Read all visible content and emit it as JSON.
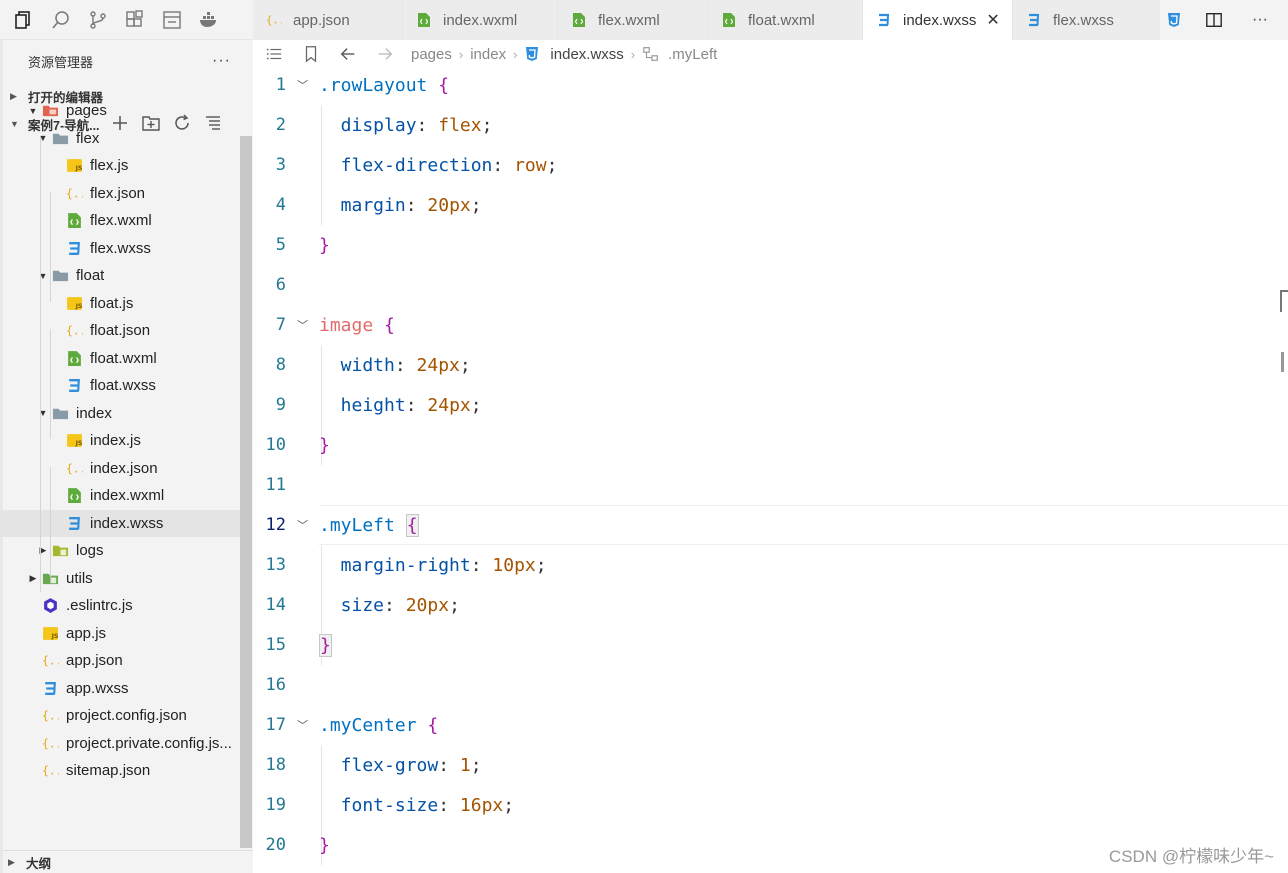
{
  "activity_bar": {
    "icons": [
      "files-icon",
      "search-icon",
      "source-control-icon",
      "extensions-icon",
      "debug-console-icon",
      "docker-icon"
    ]
  },
  "explorer": {
    "title": "资源管理器",
    "more": "···",
    "open_editors": "打开的编辑器",
    "project": "案例7-导航...",
    "outline": "大纲"
  },
  "tree": [
    {
      "label": "pages",
      "icon": "folder-pages-icon",
      "twisty": "▼"
    },
    {
      "label": "flex",
      "icon": "folder-icon",
      "twisty": "▼"
    },
    {
      "label": "flex.js",
      "icon": "js-file-icon"
    },
    {
      "label": "flex.json",
      "icon": "json-file-icon"
    },
    {
      "label": "flex.wxml",
      "icon": "wxml-file-icon"
    },
    {
      "label": "flex.wxss",
      "icon": "wxss-file-icon"
    },
    {
      "label": "float",
      "icon": "folder-icon",
      "twisty": "▼"
    },
    {
      "label": "float.js",
      "icon": "js-file-icon"
    },
    {
      "label": "float.json",
      "icon": "json-file-icon"
    },
    {
      "label": "float.wxml",
      "icon": "wxml-file-icon"
    },
    {
      "label": "float.wxss",
      "icon": "wxss-file-icon"
    },
    {
      "label": "index",
      "icon": "folder-icon",
      "twisty": "▼"
    },
    {
      "label": "index.js",
      "icon": "js-file-icon"
    },
    {
      "label": "index.json",
      "icon": "json-file-icon"
    },
    {
      "label": "index.wxml",
      "icon": "wxml-file-icon"
    },
    {
      "label": "index.wxss",
      "icon": "wxss-file-icon",
      "selected": true
    },
    {
      "label": "logs",
      "icon": "folder-logs-icon",
      "twisty": "▶"
    },
    {
      "label": "utils",
      "icon": "folder-utils-icon",
      "twisty": "▶"
    },
    {
      "label": ".eslintrc.js",
      "icon": "eslint-file-icon"
    },
    {
      "label": "app.js",
      "icon": "js-file-icon"
    },
    {
      "label": "app.json",
      "icon": "json-file-icon"
    },
    {
      "label": "app.wxss",
      "icon": "wxss-file-icon"
    },
    {
      "label": "project.config.json",
      "icon": "json-file-icon"
    },
    {
      "label": "project.private.config.js...",
      "icon": "json-file-icon"
    },
    {
      "label": "sitemap.json",
      "icon": "json-file-icon"
    }
  ],
  "tabs": [
    {
      "label": "app.json",
      "icon": "json-file-icon"
    },
    {
      "label": "index.wxml",
      "icon": "wxml-file-icon"
    },
    {
      "label": "flex.wxml",
      "icon": "wxml-file-icon"
    },
    {
      "label": "float.wxml",
      "icon": "wxml-file-icon"
    },
    {
      "label": "index.wxss",
      "icon": "wxss-file-icon",
      "active": true,
      "close": "✕"
    },
    {
      "label": "flex.wxss",
      "icon": "wxss-file-icon"
    }
  ],
  "breadcrumb": {
    "items": [
      "pages",
      "index",
      "index.wxss",
      ".myLeft"
    ]
  },
  "editor": {
    "current_line": 12,
    "lines": [
      {
        "n": "1",
        "fold": "﹀",
        "tokens": [
          [
            ".rowLayout",
            "sel-c"
          ],
          [
            " ",
            ""
          ],
          [
            "{",
            "brace"
          ]
        ]
      },
      {
        "n": "2",
        "tokens": [
          [
            "  display",
            "prop"
          ],
          [
            ": ",
            "punc"
          ],
          [
            "flex",
            "val"
          ],
          [
            ";",
            "punc"
          ]
        ]
      },
      {
        "n": "3",
        "tokens": [
          [
            "  flex-direction",
            "prop"
          ],
          [
            ": ",
            "punc"
          ],
          [
            "row",
            "val"
          ],
          [
            ";",
            "punc"
          ]
        ]
      },
      {
        "n": "4",
        "tokens": [
          [
            "  margin",
            "prop"
          ],
          [
            ": ",
            "punc"
          ],
          [
            "20px",
            "val"
          ],
          [
            ";",
            "punc"
          ]
        ]
      },
      {
        "n": "5",
        "tokens": [
          [
            "}",
            "brace"
          ]
        ]
      },
      {
        "n": "6",
        "tokens": []
      },
      {
        "n": "7",
        "fold": "﹀",
        "tokens": [
          [
            "image",
            "tag"
          ],
          [
            " ",
            ""
          ],
          [
            "{",
            "brace"
          ]
        ]
      },
      {
        "n": "8",
        "tokens": [
          [
            "  width",
            "prop"
          ],
          [
            ": ",
            "punc"
          ],
          [
            "24px",
            "val"
          ],
          [
            ";",
            "punc"
          ]
        ]
      },
      {
        "n": "9",
        "tokens": [
          [
            "  height",
            "prop"
          ],
          [
            ": ",
            "punc"
          ],
          [
            "24px",
            "val"
          ],
          [
            ";",
            "punc"
          ]
        ]
      },
      {
        "n": "10",
        "tokens": [
          [
            "}",
            "brace"
          ]
        ]
      },
      {
        "n": "11",
        "tokens": []
      },
      {
        "n": "12",
        "fold": "﹀",
        "tokens": [
          [
            ".myLeft",
            "sel-c"
          ],
          [
            " ",
            ""
          ],
          [
            "{",
            "brace brk-box"
          ]
        ]
      },
      {
        "n": "13",
        "tokens": [
          [
            "  margin-right",
            "prop"
          ],
          [
            ": ",
            "punc"
          ],
          [
            "10px",
            "val"
          ],
          [
            ";",
            "punc"
          ]
        ]
      },
      {
        "n": "14",
        "tokens": [
          [
            "  size",
            "prop"
          ],
          [
            ": ",
            "punc"
          ],
          [
            "20px",
            "val"
          ],
          [
            ";",
            "punc"
          ]
        ]
      },
      {
        "n": "15",
        "tokens": [
          [
            "}",
            "brace brk-box"
          ]
        ]
      },
      {
        "n": "16",
        "tokens": []
      },
      {
        "n": "17",
        "fold": "﹀",
        "tokens": [
          [
            ".myCenter",
            "sel-c"
          ],
          [
            " ",
            ""
          ],
          [
            "{",
            "brace"
          ]
        ]
      },
      {
        "n": "18",
        "tokens": [
          [
            "  flex-grow",
            "prop"
          ],
          [
            ": ",
            "punc"
          ],
          [
            "1",
            "val"
          ],
          [
            ";",
            "punc"
          ]
        ]
      },
      {
        "n": "19",
        "tokens": [
          [
            "  font-size",
            "prop"
          ],
          [
            ": ",
            "punc"
          ],
          [
            "16px",
            "val"
          ],
          [
            ";",
            "punc"
          ]
        ]
      },
      {
        "n": "20",
        "tokens": [
          [
            "}",
            "brace"
          ]
        ]
      }
    ]
  },
  "watermark": "CSDN @柠檬味少年~",
  "colors": {
    "wxss": "#2f8fdc",
    "json": "#e6a817",
    "js": "#f5c518",
    "wxml": "#5faa3c",
    "folder": "#8a9ba8",
    "pages_folder": "#e0654f"
  }
}
